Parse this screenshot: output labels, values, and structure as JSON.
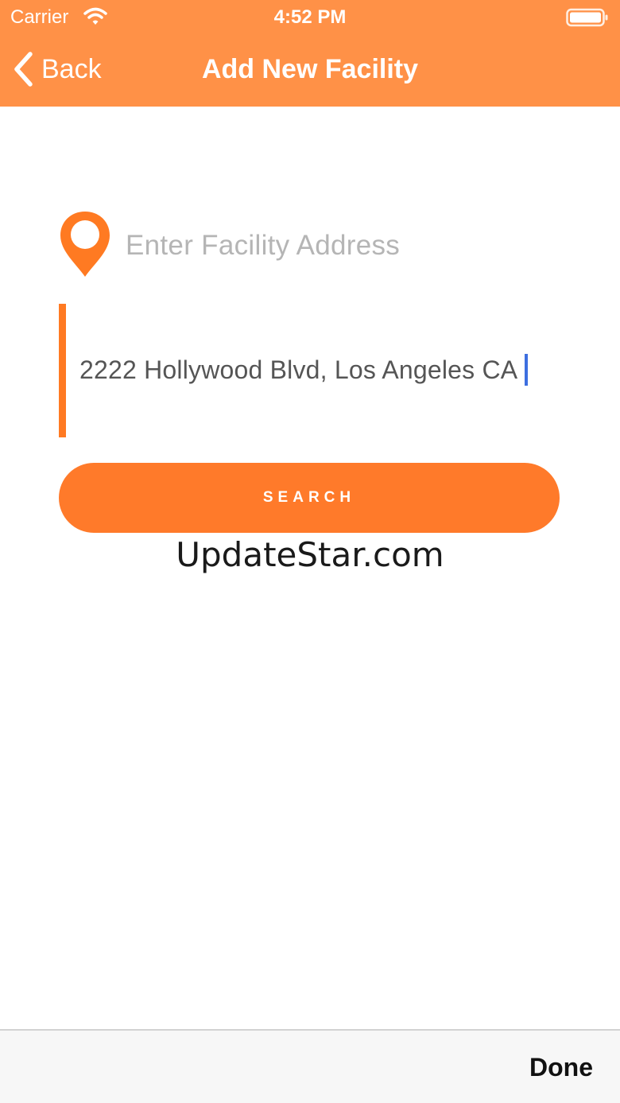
{
  "status_bar": {
    "carrier": "Carrier",
    "time": "4:52 PM"
  },
  "nav_bar": {
    "back_label": "Back",
    "title": "Add New Facility"
  },
  "form": {
    "address_label": "Enter Facility Address",
    "address_value": "2222 Hollywood Blvd, Los Angeles CA",
    "search_label": "SEARCH"
  },
  "watermark": "UpdateStar.com",
  "accessory_bar": {
    "done_label": "Done"
  },
  "colors": {
    "header": "#ff9147",
    "accent": "#ff7a22",
    "caret": "#3d6fe0"
  },
  "icons": {
    "wifi": "wifi-icon",
    "battery": "battery-icon",
    "back": "chevron-left-icon",
    "address": "location-pin-icon"
  }
}
